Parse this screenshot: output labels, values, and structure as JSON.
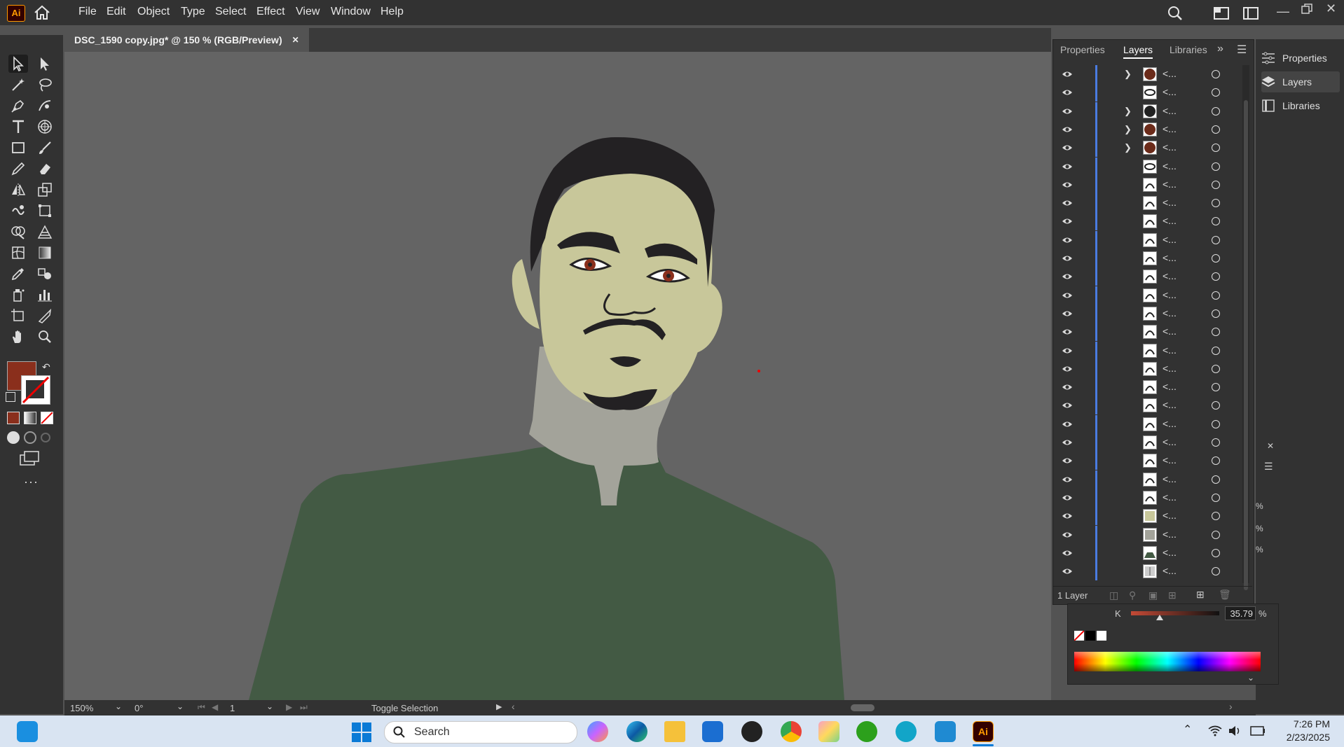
{
  "app": {
    "logo": "Ai",
    "menu": [
      "File",
      "Edit",
      "Object",
      "Type",
      "Select",
      "Effect",
      "View",
      "Window",
      "Help"
    ]
  },
  "document": {
    "tab_title": "DSC_1590 copy.jpg* @ 150 % (RGB/Preview)",
    "close_glyph": "✕"
  },
  "colors": {
    "fill_swatch": "#8a2f1c",
    "skin": "#c8c79a",
    "neck": "#a3a39a",
    "shirt": "#435a44",
    "hair": "#232123",
    "iris": "#8a2f1c",
    "canvas_bg": "#646464"
  },
  "layers_panel": {
    "tabs": [
      "Properties",
      "Layers",
      "Libraries"
    ],
    "row_label": "<...",
    "rows": [
      {
        "chevron": true,
        "thumb": "brown-circle"
      },
      {
        "chevron": false,
        "thumb": "eye"
      },
      {
        "chevron": true,
        "thumb": "dark-circle"
      },
      {
        "chevron": true,
        "thumb": "brown-circle"
      },
      {
        "chevron": true,
        "thumb": "brown-circle"
      },
      {
        "chevron": false,
        "thumb": "eye"
      },
      {
        "chevron": false,
        "thumb": "shape"
      },
      {
        "chevron": false,
        "thumb": "shape"
      },
      {
        "chevron": false,
        "thumb": "shape"
      },
      {
        "chevron": false,
        "thumb": "shape"
      },
      {
        "chevron": false,
        "thumb": "shape"
      },
      {
        "chevron": false,
        "thumb": "shape"
      },
      {
        "chevron": false,
        "thumb": "shape"
      },
      {
        "chevron": false,
        "thumb": "shape"
      },
      {
        "chevron": false,
        "thumb": "shape"
      },
      {
        "chevron": false,
        "thumb": "shape"
      },
      {
        "chevron": false,
        "thumb": "shape"
      },
      {
        "chevron": false,
        "thumb": "shape"
      },
      {
        "chevron": false,
        "thumb": "shape"
      },
      {
        "chevron": false,
        "thumb": "shape"
      },
      {
        "chevron": false,
        "thumb": "shape"
      },
      {
        "chevron": false,
        "thumb": "shape"
      },
      {
        "chevron": false,
        "thumb": "shape"
      },
      {
        "chevron": false,
        "thumb": "shape"
      },
      {
        "chevron": false,
        "thumb": "skin"
      },
      {
        "chevron": false,
        "thumb": "gray"
      },
      {
        "chevron": false,
        "thumb": "green"
      },
      {
        "chevron": false,
        "thumb": "photo"
      }
    ],
    "footer_label": "1 Layer"
  },
  "dock": {
    "items": [
      "Properties",
      "Layers",
      "Libraries"
    ]
  },
  "color_panel": {
    "channel_label": "K",
    "value": "35.79",
    "unit": "%",
    "percent_labels": [
      "%",
      "%",
      "%"
    ]
  },
  "status": {
    "zoom": "150%",
    "rotation": "0°",
    "artboard": "1",
    "mode": "Toggle Selection"
  },
  "taskbar": {
    "search_placeholder": "Search",
    "time": "7:26 PM",
    "date": "2/23/2025"
  }
}
